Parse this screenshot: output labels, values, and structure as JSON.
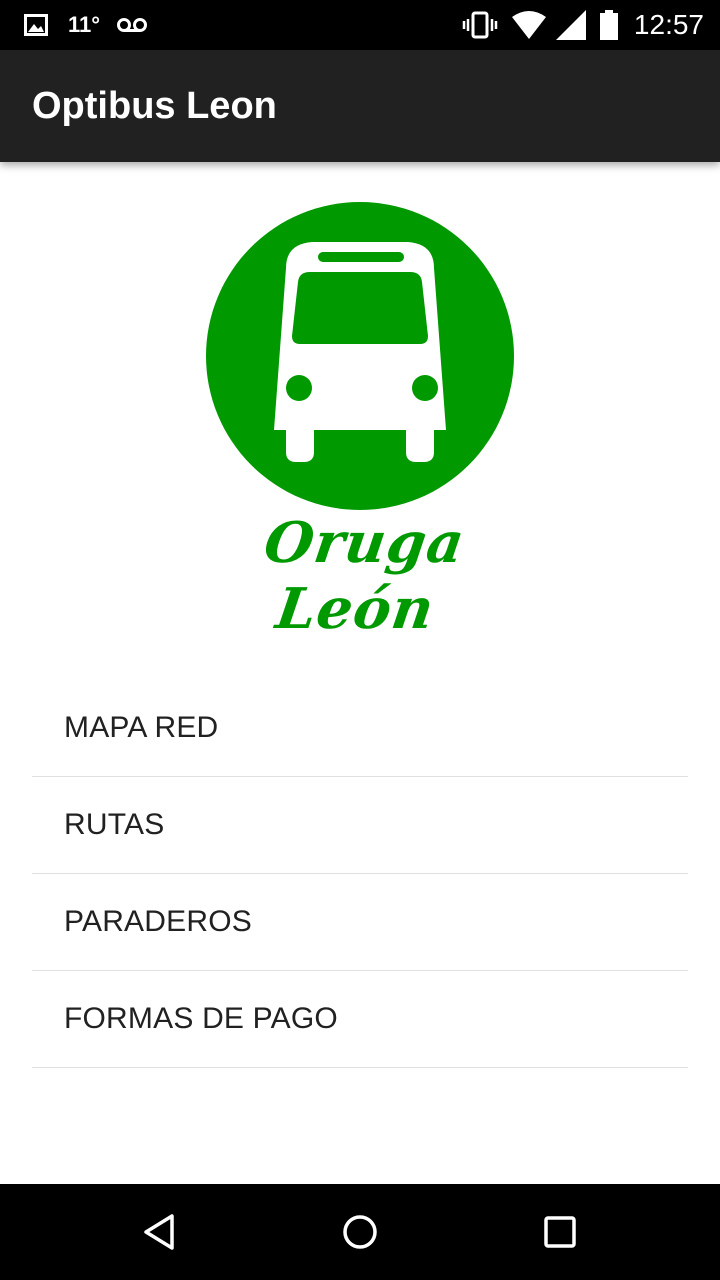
{
  "status_bar": {
    "temperature": "11°",
    "time": "12:57",
    "icons": [
      "image-notification-icon",
      "voicemail-icon",
      "vibrate-icon",
      "wifi-icon",
      "cell-signal-icon",
      "battery-icon"
    ]
  },
  "app_bar": {
    "title": "Optibus Leon",
    "background": "#212121"
  },
  "logo": {
    "text": "Oruga León",
    "color": "#009900",
    "icon": "bus-icon"
  },
  "menu": {
    "items": [
      {
        "label": "MAPA RED"
      },
      {
        "label": "RUTAS"
      },
      {
        "label": "PARADEROS"
      },
      {
        "label": "FORMAS DE PAGO"
      }
    ]
  },
  "nav_bar": {
    "icons": [
      "back-icon",
      "home-icon",
      "recents-icon"
    ]
  }
}
